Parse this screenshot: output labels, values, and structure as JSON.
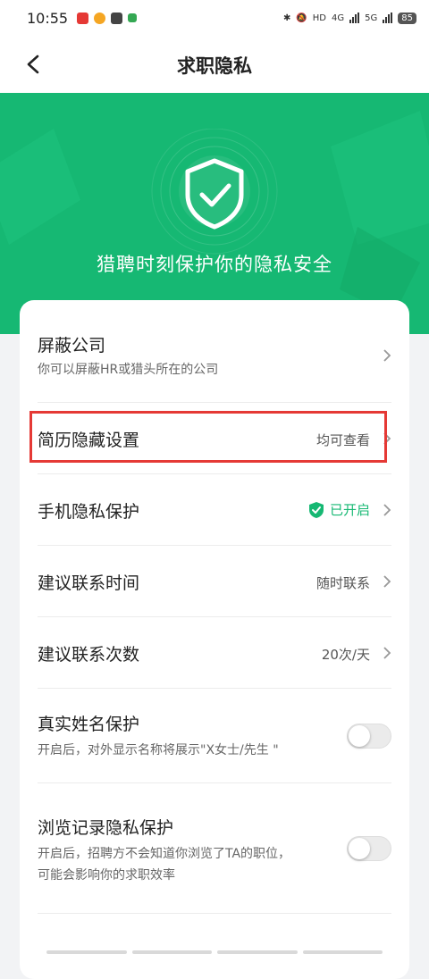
{
  "status_bar": {
    "time": "10:55",
    "network_labels": [
      "HD",
      "4G",
      "5G"
    ],
    "battery": "85"
  },
  "header": {
    "title": "求职隐私"
  },
  "banner": {
    "tagline": "猎聘时刻保护你的隐私安全",
    "brand_color": "#16b873"
  },
  "settings": {
    "block_company": {
      "title": "屏蔽公司",
      "subtitle": "你可以屏蔽HR或猎头所在的公司"
    },
    "resume_hide": {
      "title": "简历隐藏设置",
      "value": "均可查看"
    },
    "phone_privacy": {
      "title": "手机隐私保护",
      "status": "已开启"
    },
    "contact_time": {
      "title": "建议联系时间",
      "value": "随时联系"
    },
    "contact_count": {
      "title": "建议联系次数",
      "value": "20次/天"
    },
    "real_name": {
      "title": "真实姓名保护",
      "subtitle": "开启后，对外显示名称将展示\"X女士/先生 \"",
      "enabled": false
    },
    "browse_history": {
      "title": "浏览记录隐私保护",
      "subtitle_line1": "开启后，招聘方不会知道你浏览了TA的职位，",
      "subtitle_line2": "可能会影响你的求职效率",
      "enabled": false
    }
  },
  "annotation": {
    "highlight_color": "#e53935"
  }
}
